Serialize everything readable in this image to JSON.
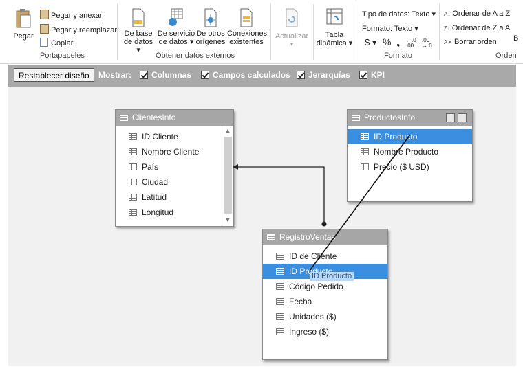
{
  "ribbon": {
    "clipboard": {
      "pegar": "Pegar",
      "pegar_anexar": "Pegar y anexar",
      "pegar_reemplazar": "Pegar y reemplazar",
      "copiar": "Copiar",
      "group_label": "Portapapeles"
    },
    "external": {
      "db_line1": "De base",
      "db_line2": "de datos ▾",
      "ws_line1": "De servicio",
      "ws_line2": "de datos ▾",
      "other_line1": "De otros",
      "other_line2": "orígenes",
      "conn_line1": "Conexiones",
      "conn_line2": "existentes",
      "group_label": "Obtener datos externos"
    },
    "refresh": {
      "label": "Actualizar",
      "arrow": "▾"
    },
    "pivot": {
      "line1": "Tabla",
      "line2": "dinámica ▾"
    },
    "format": {
      "tipo": "Tipo de datos: Texto ▾",
      "formato": "Formato: Texto ▾",
      "dollar": "$ ▾",
      "percent": "%",
      "comma": "❟",
      "inc": "←.0 .00",
      "dec": ".00 →.0",
      "group_label": "Formato"
    },
    "sort": {
      "az": "Ordenar de A a Z",
      "za": "Ordenar de Z a A",
      "clear": "Borrar orden",
      "group_label": "Orden",
      "cut_label": "B"
    }
  },
  "toolbar": {
    "reset": "Restablecer diseño",
    "mostrar": "Mostrar:",
    "options": [
      "Columnas",
      "Campos calculados",
      "Jerarquías",
      "KPI"
    ]
  },
  "tables": {
    "clientes": {
      "title": "ClientesInfo",
      "fields": [
        "ID Cliente",
        "Nombre  Cliente",
        "País",
        "Ciudad",
        "Latitud",
        "Longitud"
      ]
    },
    "productos": {
      "title": "ProductosInfo",
      "fields": [
        "ID Producto",
        "Nombre   Producto",
        "Precio ($ USD)"
      ]
    },
    "ventas": {
      "title": "RegistroVentas",
      "fields": [
        "ID de Cliente",
        "ID Producto",
        "Código Pedido",
        "Fecha",
        "Unidades ($)",
        "Ingreso ($)"
      ]
    }
  },
  "drag_tooltip": "ID Producto",
  "colors": {
    "selection": "#3b8fe0",
    "header": "#a6a6a6",
    "canvas": "#f1f1f1"
  }
}
